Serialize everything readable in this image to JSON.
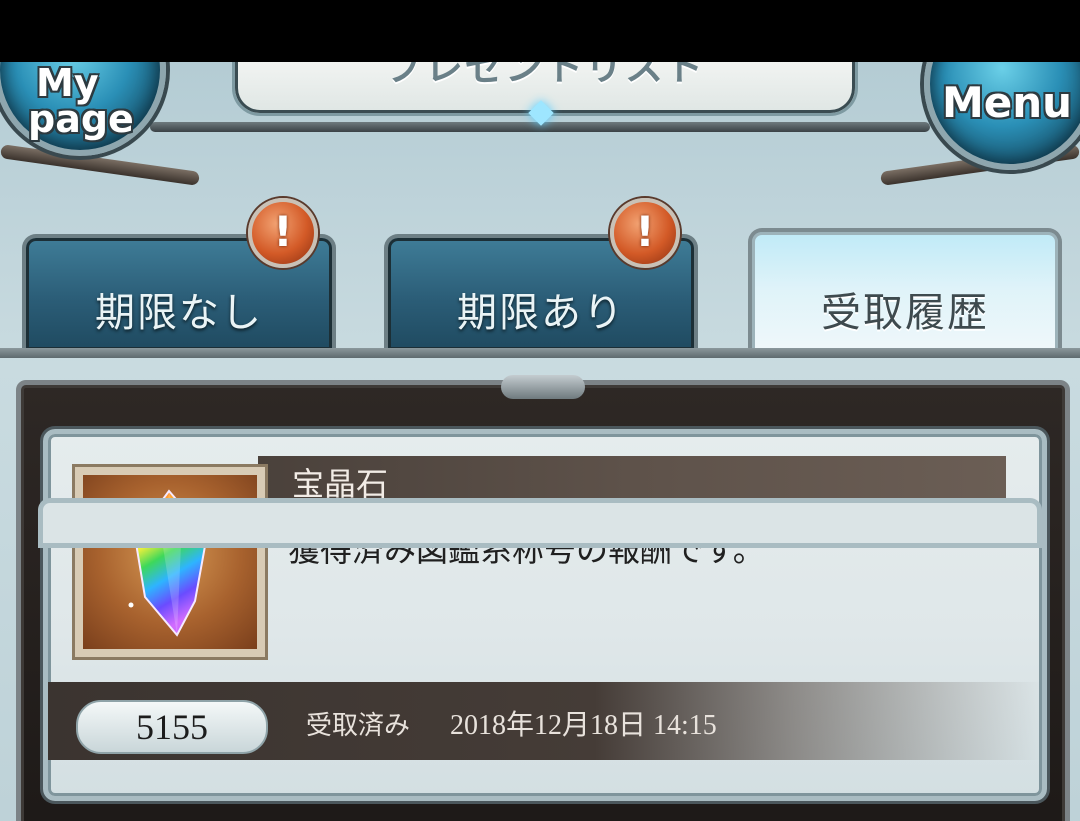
{
  "header": {
    "title": "プレゼントリスト",
    "mypage_line1": "My",
    "mypage_line2": "page",
    "menu_label": "Menu"
  },
  "tabs": [
    {
      "label": "期限なし",
      "badge": "!",
      "active": false
    },
    {
      "label": "期限あり",
      "badge": "!",
      "active": false
    },
    {
      "label": "受取履歴",
      "badge": "",
      "active": true
    }
  ],
  "item": {
    "name": "宝晶石",
    "description": "獲得済み図鑑系称号の報酬です。",
    "quantity": "5155",
    "status": "受取済み",
    "received_at": "2018年12月18日  14:15",
    "icon": "rainbow-crystal-icon"
  },
  "colors": {
    "tab_active": "#dff3f9",
    "tab_inactive": "#2b5d77",
    "badge": "#d35a27",
    "panel": "#2e2825"
  }
}
